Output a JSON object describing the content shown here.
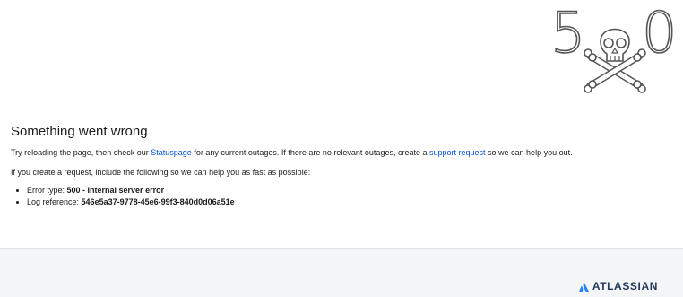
{
  "error_art": {
    "digit_left": "5",
    "digit_right": "0"
  },
  "error": {
    "heading": "Something went wrong",
    "intro_before_status": "Try reloading the page, then check our ",
    "statuspage_link": "Statuspage",
    "intro_middle": " for any current outages. If there are no relevant outages, create a ",
    "support_link": "support request",
    "intro_after": " so we can help you out.",
    "request_instructions": "If you create a request, include the following so we can help you as fast as possible:",
    "details": {
      "error_type_label": "Error type: ",
      "error_type_value": "500 - Internal server error",
      "log_reference_label": "Log reference: ",
      "log_reference_value": "546e5a37-9778-45e6-99f3-840d0d06a51e"
    }
  },
  "footer": {
    "brand_name": "ATLASSIAN",
    "brand_icon": "atlassian-logo-icon"
  },
  "colors": {
    "link": "#0052cc",
    "footer_bg": "#f4f5f7",
    "brand": "#253858"
  }
}
